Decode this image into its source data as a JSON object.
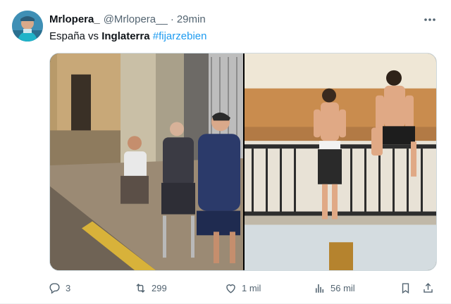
{
  "tweet": {
    "display_name": "Mrlopera_",
    "handle": "@Mrlopera__",
    "separator": "·",
    "time": "29min",
    "text_prefix": "España vs ",
    "text_bold": "Inglaterra",
    "text_space": " ",
    "hashtag": "#fijarzebien"
  },
  "actions": {
    "replies": "3",
    "retweets": "299",
    "likes": "1 mil",
    "views": "56 mil"
  },
  "colors": {
    "accent": "#1d9bf0",
    "muted": "#536471",
    "text": "#0f1419"
  },
  "icons": [
    "avatar-image",
    "more-icon",
    "reply-icon",
    "retweet-icon",
    "like-icon",
    "views-icon",
    "bookmark-icon",
    "share-icon"
  ]
}
